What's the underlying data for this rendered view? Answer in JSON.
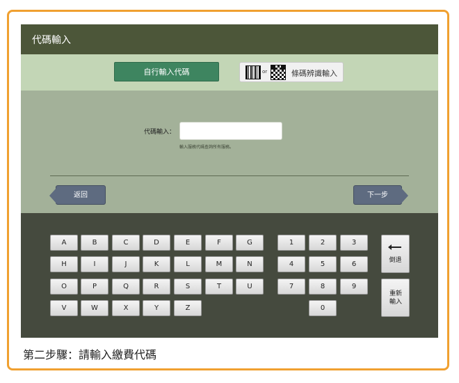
{
  "window_title": "代碼輸入",
  "tabs": {
    "manual_label": "自行輸入代碼",
    "or_text": "or",
    "scan_label": "條碼辨識輸入"
  },
  "form": {
    "code_label": "代碼輸入：",
    "input_value": "",
    "hint": "輸入服務代碼查詢所有服務。"
  },
  "nav": {
    "back_label": "返回",
    "next_label": "下一步"
  },
  "keyboard": {
    "rows": [
      [
        "A",
        "B",
        "C",
        "D",
        "E",
        "F",
        "G"
      ],
      [
        "H",
        "I",
        "J",
        "K",
        "L",
        "M",
        "N"
      ],
      [
        "O",
        "P",
        "Q",
        "R",
        "S",
        "T",
        "U"
      ],
      [
        "V",
        "W",
        "X",
        "Y",
        "Z"
      ]
    ],
    "digit_rows": [
      [
        "1",
        "2",
        "3"
      ],
      [
        "4",
        "5",
        "6"
      ],
      [
        "7",
        "8",
        "9"
      ],
      [
        "0"
      ]
    ],
    "backspace_label": "倒退",
    "reset_label": "重新輸入"
  },
  "caption": "第二步驟：請輸入繳費代碼",
  "colors": {
    "frame": "#f0a030",
    "titlebar": "#4c5639",
    "tab_active": "#3e8560",
    "nav_button": "#5e6b80",
    "keyboard_bg": "#454a3e"
  }
}
